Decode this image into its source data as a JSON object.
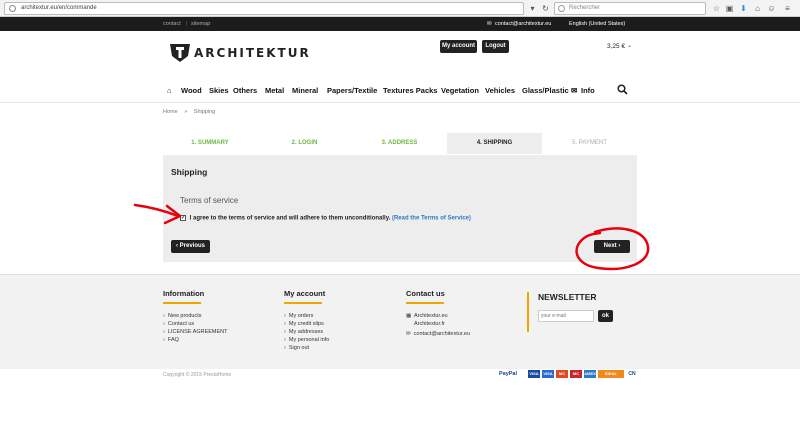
{
  "browser": {
    "url": "architextur.eu/en/commande",
    "search_placeholder": "Rechercher"
  },
  "topbar": {
    "contact": "contact",
    "sitemap": "sitemap",
    "email": "contact@architextur.eu",
    "language": "English (United States)"
  },
  "header": {
    "logo_text": "ARCHITEKTUR",
    "my_account": "My account",
    "logout": "Logout",
    "cart_total": "3,25 €"
  },
  "nav": {
    "items": [
      "Wood",
      "Skies",
      "Others",
      "Metal",
      "Mineral",
      "Papers/Textile",
      "Textures Packs",
      "Vegetation",
      "Vehicles",
      "Glass/Plastic",
      "Info"
    ]
  },
  "breadcrumb": {
    "home": "Home",
    "sep": "»",
    "current": "Shipping"
  },
  "steps": [
    {
      "label": "1. SUMMARY",
      "state": "done"
    },
    {
      "label": "2. LOGIN",
      "state": "done"
    },
    {
      "label": "3. ADDRESS",
      "state": "done"
    },
    {
      "label": "4. SHIPPING",
      "state": "current"
    },
    {
      "label": "5. PAYMENT",
      "state": "todo"
    }
  ],
  "shipping": {
    "title": "Shipping",
    "tos_heading": "Terms of service",
    "agree_text": "I agree to the terms of service and will adhere to them unconditionally.",
    "read_link": "(Read the Terms of Service)",
    "checked": true,
    "previous": "Previous",
    "next": "Next"
  },
  "footer": {
    "information": {
      "title": "Information",
      "items": [
        "New products",
        "Contact us",
        "LICENSE AGREEMENT",
        "FAQ"
      ]
    },
    "account": {
      "title": "My account",
      "items": [
        "My orders",
        "My credit slips",
        "My addresses",
        "My personal info",
        "Sign out"
      ]
    },
    "contact": {
      "title": "Contact us",
      "line1": "Architextur.eu",
      "line2": "Architextur.fr",
      "email": "contact@architextur.eu"
    },
    "newsletter": {
      "title": "NEWSLETTER",
      "placeholder": "your e-mail",
      "button": "ok"
    },
    "copyright": "Copyright © 2015 PrestaHome",
    "payments": [
      "PayPal",
      "VISA",
      "VISA",
      "MC",
      "MC",
      "AMEX",
      "",
      "IDEAL",
      "CN"
    ]
  },
  "colors": {
    "step_done": "#6bb842",
    "accent": "#f0a500",
    "dark": "#222222",
    "annotation": "#e8000c"
  }
}
